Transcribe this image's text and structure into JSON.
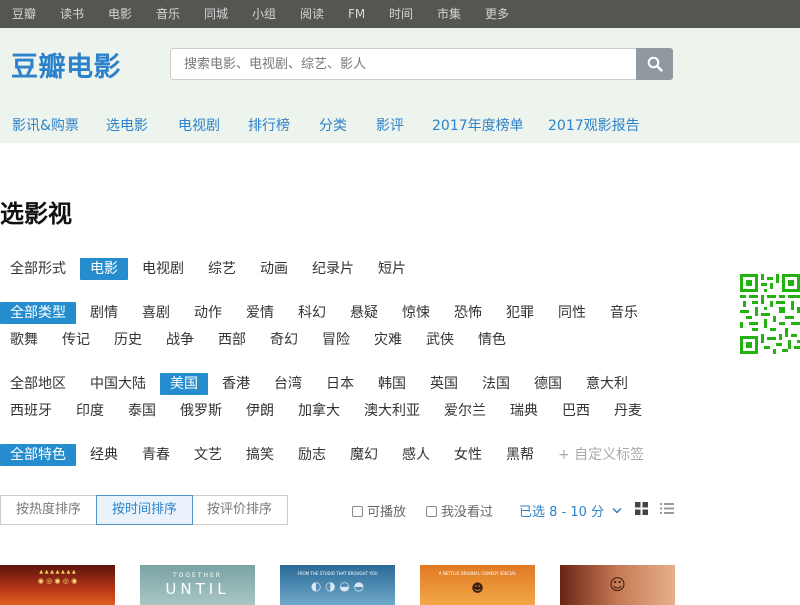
{
  "global_nav": [
    "豆瓣",
    "读书",
    "电影",
    "音乐",
    "同城",
    "小组",
    "阅读",
    "FM",
    "时间",
    "市集",
    "更多"
  ],
  "header": {
    "logo": "豆瓣电影",
    "search_placeholder": "搜索电影、电视剧、综艺、影人",
    "search_icon": "search-icon",
    "sub_nav": [
      "影讯&购票",
      "选电影",
      "电视剧",
      "排行榜",
      "分类",
      "影评",
      "2017年度榜单",
      "2017观影报告"
    ]
  },
  "page_title": "选影视",
  "filters": {
    "form": {
      "tags": [
        "全部形式",
        "电影",
        "电视剧",
        "综艺",
        "动画",
        "纪录片",
        "短片"
      ],
      "selected": "电影"
    },
    "genre": {
      "tags": [
        "全部类型",
        "剧情",
        "喜剧",
        "动作",
        "爱情",
        "科幻",
        "悬疑",
        "惊悚",
        "恐怖",
        "犯罪",
        "同性",
        "音乐",
        "歌舞",
        "传记",
        "历史",
        "战争",
        "西部",
        "奇幻",
        "冒险",
        "灾难",
        "武侠",
        "情色"
      ],
      "selected": "全部类型"
    },
    "region": {
      "tags": [
        "全部地区",
        "中国大陆",
        "美国",
        "香港",
        "台湾",
        "日本",
        "韩国",
        "英国",
        "法国",
        "德国",
        "意大利",
        "西班牙",
        "印度",
        "泰国",
        "俄罗斯",
        "伊朗",
        "加拿大",
        "澳大利亚",
        "爱尔兰",
        "瑞典",
        "巴西",
        "丹麦"
      ],
      "selected": "美国"
    },
    "feature": {
      "tags": [
        "全部特色",
        "经典",
        "青春",
        "文艺",
        "搞笑",
        "励志",
        "魔幻",
        "感人",
        "女性",
        "黑帮",
        "+ 自定义标签"
      ],
      "selected": "全部特色"
    }
  },
  "sort": {
    "options": [
      "按热度排序",
      "按时间排序",
      "按评价排序"
    ],
    "selected": "按时间排序",
    "checks": [
      "可播放",
      "我没看过"
    ],
    "rating_filter": "已选 8 - 10 分",
    "view_icons": [
      "grid-view-icon",
      "list-view-icon"
    ]
  },
  "posters": [
    {
      "text": "",
      "colors": [
        "#6a1810",
        "#c43a16"
      ]
    },
    {
      "text": "TOGETHER",
      "big": "UNTIL",
      "colors": [
        "#6f9aa0",
        "#a9c6c2"
      ]
    },
    {
      "text": "FROM THE STUDIO THAT BROUGHT YOU",
      "colors": [
        "#2d6d98",
        "#7bb1cf"
      ]
    },
    {
      "text": "A NETFLIX ORIGINAL COMEDY SPECIAL",
      "colors": [
        "#d07020",
        "#f0a040"
      ]
    },
    {
      "text": "",
      "colors": [
        "#7a2a1a",
        "#e0a080"
      ]
    }
  ],
  "colors": {
    "accent": "#2e82c9",
    "active_tag": "#258dcd",
    "header_bg": "#edf4ed",
    "global_nav_bg": "#545652",
    "qr": "#22b311"
  }
}
